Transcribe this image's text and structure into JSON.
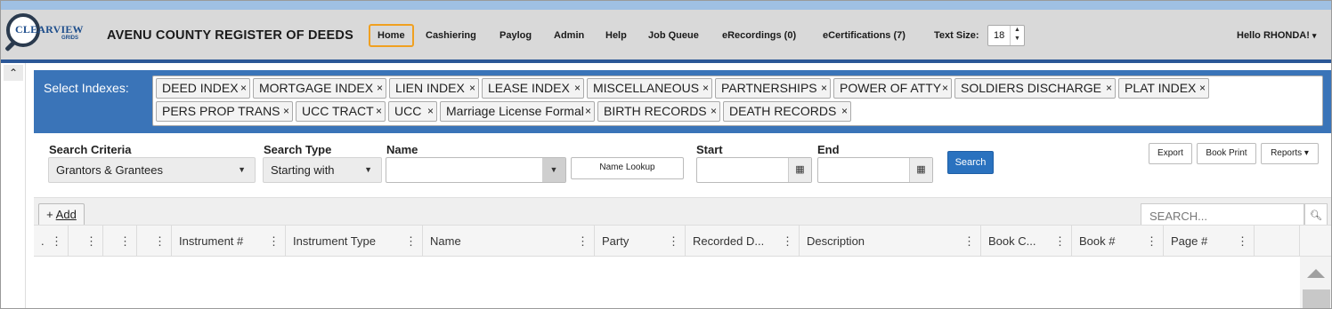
{
  "header": {
    "logo_brand": "CLEARVIEW",
    "logo_sub": "GRIDS",
    "title": "AVENU COUNTY REGISTER OF DEEDS",
    "nav": [
      {
        "label": "Home",
        "active": true
      },
      {
        "label": "Cashiering"
      },
      {
        "label": "Paylog"
      },
      {
        "label": "Admin"
      },
      {
        "label": "Help"
      },
      {
        "label": "Job Queue"
      },
      {
        "label": "eRecordings (0)"
      },
      {
        "label": "eCertifications (7)"
      }
    ],
    "text_size_label": "Text Size:",
    "text_size_value": "18",
    "user_greeting": "Hello RHONDA!",
    "accent_color": "#2b5797",
    "active_tab_border": "#f0a020"
  },
  "collapse": {
    "icon": "chevron-up-icon",
    "glyph": "⌃"
  },
  "indexes": {
    "label": "Select Indexes:",
    "selected": [
      "DEED INDEX",
      "MORTGAGE INDEX",
      "LIEN INDEX",
      "LEASE INDEX",
      "MISCELLANEOUS",
      "PARTNERSHIPS",
      "POWER OF ATTY",
      "SOLDIERS DISCHARGE",
      "PLAT INDEX",
      "PERS PROP TRANS",
      "UCC TRACT",
      "UCC",
      "Marriage License Formal",
      "BIRTH RECORDS",
      "DEATH RECORDS"
    ],
    "remove_glyph": "×",
    "panel_color": "#3a74b8"
  },
  "criteria": {
    "search_criteria_label": "Search Criteria",
    "search_criteria_value": "Grantors & Grantees",
    "search_type_label": "Search Type",
    "search_type_value": "Starting with",
    "name_label": "Name",
    "name_value": "",
    "name_lookup_label": "Name Lookup",
    "start_label": "Start",
    "start_value": "",
    "end_label": "End",
    "end_value": "",
    "search_button": "Search",
    "export_button": "Export",
    "book_print_button": "Book Print",
    "reports_button": "Reports",
    "primary_color": "#2a72bf"
  },
  "grid": {
    "add_button": "Add",
    "add_prefix": "+ ",
    "search_placeholder": "SEARCH...",
    "columns": [
      ".",
      "",
      "",
      "",
      "Instrument #",
      "Instrument Type",
      "Name",
      "Party",
      "Recorded D...",
      "Description",
      "Book C...",
      "Book #",
      "Page #",
      ""
    ],
    "rows": []
  }
}
